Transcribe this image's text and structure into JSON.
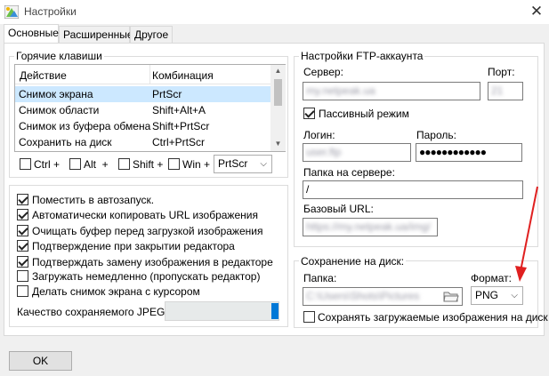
{
  "window": {
    "title": "Настройки"
  },
  "tabs": [
    {
      "label": "Основные",
      "active": true
    },
    {
      "label": "Расширенные",
      "active": false
    },
    {
      "label": "Другое",
      "active": false
    }
  ],
  "hotkeys": {
    "group_title": "Горячие клавиши",
    "columns": [
      "Действие",
      "Комбинация"
    ],
    "rows": [
      {
        "action": "Снимок экрана",
        "combo": "PrtScr",
        "selected": true
      },
      {
        "action": "Снимок области",
        "combo": "Shift+Alt+A",
        "selected": false
      },
      {
        "action": "Снимок из буфера обмена",
        "combo": "Shift+PrtScr",
        "selected": false
      },
      {
        "action": "Сохранить на диск",
        "combo": "Ctrl+PrtScr",
        "selected": false
      }
    ],
    "modifiers": [
      {
        "label": "Ctrl +",
        "checked": false
      },
      {
        "label": "Alt  +",
        "checked": false
      },
      {
        "label": "Shift +",
        "checked": false
      },
      {
        "label": "Win +",
        "checked": false
      }
    ],
    "key_select": "PrtScr"
  },
  "options": [
    {
      "label": "Поместить в автозапуск.",
      "checked": true
    },
    {
      "label": "Автоматически копировать URL изображения",
      "checked": true
    },
    {
      "label": "Очищать буфер перед загрузкой изображения",
      "checked": true
    },
    {
      "label": "Подтверждение при закрытии редактора",
      "checked": true
    },
    {
      "label": "Подтверждать замену изображения в редакторе",
      "checked": true
    },
    {
      "label": "Загружать немедленно (пропускать редактор)",
      "checked": false
    },
    {
      "label": "Делать снимок экрана с курсором",
      "checked": false
    }
  ],
  "jpeg_quality": {
    "label": "Качество сохраняемого JPEG:",
    "level": 1.0
  },
  "ftp": {
    "group_title": "Настройки FTP-аккаунта",
    "server_label": "Сервер:",
    "server_value": "my.netpeak.ua",
    "port_label": "Порт:",
    "port_value": "21",
    "passive_label": "Пассивный режим",
    "passive_checked": true,
    "login_label": "Логин:",
    "login_value": "user.ftp",
    "password_label": "Пароль:",
    "password_value": "●●●●●●●●●●●●",
    "folder_label": "Папка на сервере:",
    "folder_value": "/",
    "base_url_label": "Базовый URL:",
    "base_url_value": "https://my.netpeak.ua/img/"
  },
  "disk": {
    "group_title": "Сохранение на диск:",
    "folder_label": "Папка:",
    "folder_value": "C:\\Users\\Shots\\Pictures",
    "format_label": "Формат:",
    "format_value": "PNG",
    "save_uploaded_label": "Сохранять загружаемые изображения на диск",
    "save_uploaded_checked": false
  },
  "buttons": {
    "ok": "OK"
  },
  "colors": {
    "selection": "#cce8ff",
    "accent": "#0078d7",
    "annotation_arrow": "#e02020"
  }
}
